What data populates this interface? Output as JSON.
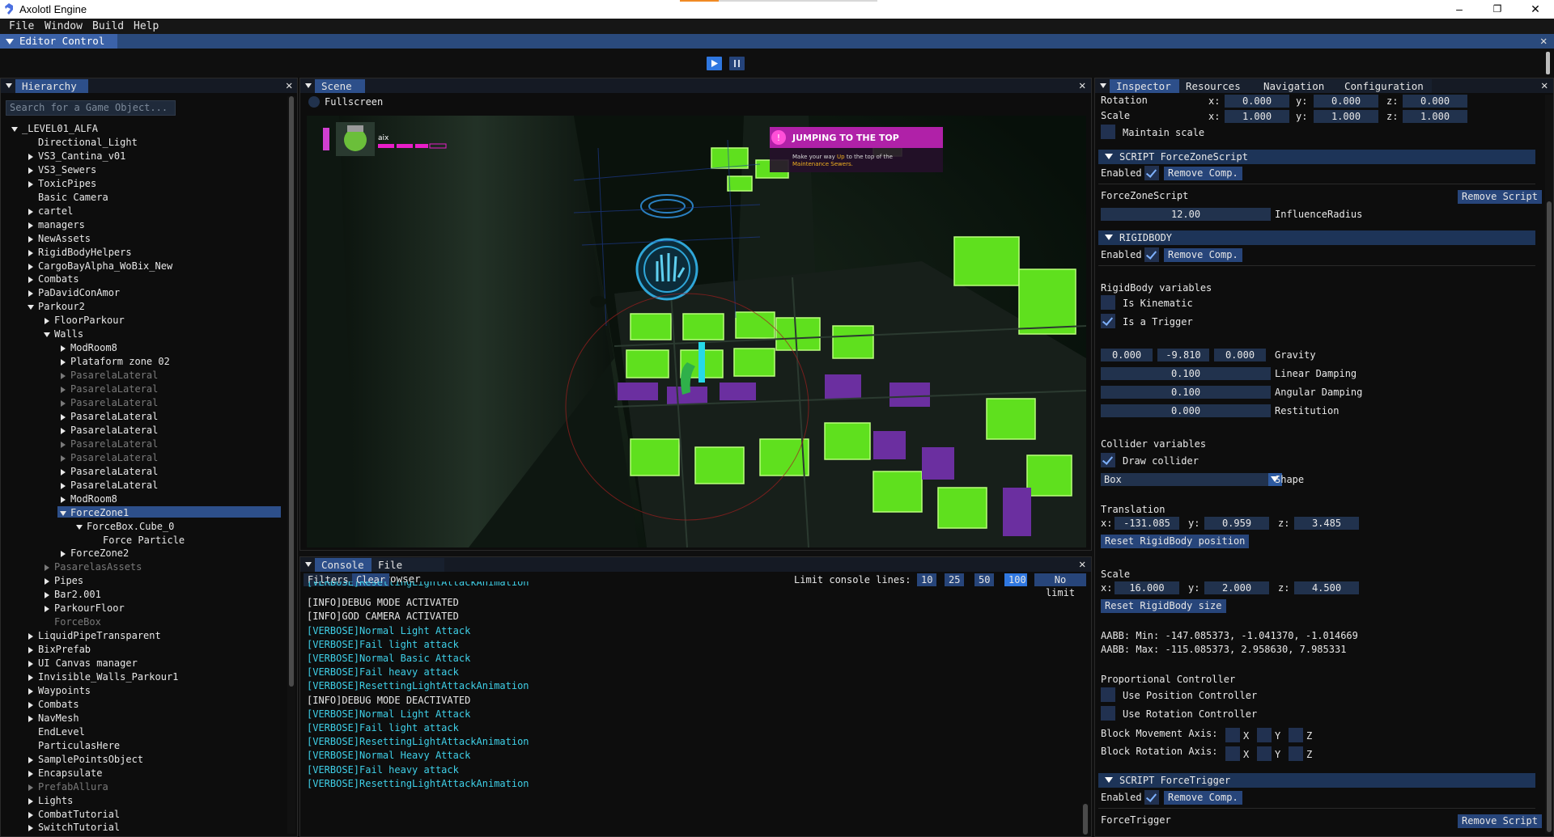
{
  "window": {
    "title": "Axolotl Engine",
    "minimize": "–",
    "maximize": "❐",
    "close": "✕"
  },
  "menu": [
    "File",
    "Window",
    "Build",
    "Help"
  ],
  "editor_control": {
    "title": "Editor Control"
  },
  "hierarchy": {
    "tab": "Hierarchy",
    "search_placeholder": "Search for a Game Object...",
    "items": [
      {
        "label": "_LEVEL01_ALFA",
        "depth": 0,
        "arrow": "down",
        "dim": false
      },
      {
        "label": "Directional_Light",
        "depth": 1,
        "arrow": "none",
        "dim": false
      },
      {
        "label": "VS3_Cantina_v01",
        "depth": 1,
        "arrow": "right",
        "dim": false
      },
      {
        "label": "VS3_Sewers",
        "depth": 1,
        "arrow": "right",
        "dim": false
      },
      {
        "label": "ToxicPipes",
        "depth": 1,
        "arrow": "right",
        "dim": false
      },
      {
        "label": "Basic Camera",
        "depth": 1,
        "arrow": "none",
        "dim": false
      },
      {
        "label": "cartel",
        "depth": 1,
        "arrow": "right",
        "dim": false
      },
      {
        "label": "managers",
        "depth": 1,
        "arrow": "right",
        "dim": false
      },
      {
        "label": "NewAssets",
        "depth": 1,
        "arrow": "right",
        "dim": false
      },
      {
        "label": "RigidBodyHelpers",
        "depth": 1,
        "arrow": "right",
        "dim": false
      },
      {
        "label": "CargoBayAlpha_WoBix_New",
        "depth": 1,
        "arrow": "right",
        "dim": false
      },
      {
        "label": "Combats",
        "depth": 1,
        "arrow": "right",
        "dim": false
      },
      {
        "label": "PaDavidConAmor",
        "depth": 1,
        "arrow": "right",
        "dim": false
      },
      {
        "label": "Parkour2",
        "depth": 1,
        "arrow": "down",
        "dim": false
      },
      {
        "label": "FloorParkour",
        "depth": 2,
        "arrow": "right",
        "dim": false
      },
      {
        "label": "Walls",
        "depth": 2,
        "arrow": "down",
        "dim": false
      },
      {
        "label": "ModRoom8",
        "depth": 3,
        "arrow": "right",
        "dim": false
      },
      {
        "label": "Plataform zone 02",
        "depth": 3,
        "arrow": "right",
        "dim": false
      },
      {
        "label": "PasarelaLateral",
        "depth": 3,
        "arrow": "right",
        "dim": true
      },
      {
        "label": "PasarelaLateral",
        "depth": 3,
        "arrow": "right",
        "dim": true
      },
      {
        "label": "PasarelaLateral",
        "depth": 3,
        "arrow": "right",
        "dim": true
      },
      {
        "label": "PasarelaLateral",
        "depth": 3,
        "arrow": "right",
        "dim": false
      },
      {
        "label": "PasarelaLateral",
        "depth": 3,
        "arrow": "right",
        "dim": false
      },
      {
        "label": "PasarelaLateral",
        "depth": 3,
        "arrow": "right",
        "dim": true
      },
      {
        "label": "PasarelaLateral",
        "depth": 3,
        "arrow": "right",
        "dim": true
      },
      {
        "label": "PasarelaLateral",
        "depth": 3,
        "arrow": "right",
        "dim": false
      },
      {
        "label": "PasarelaLateral",
        "depth": 3,
        "arrow": "right",
        "dim": false
      },
      {
        "label": "ModRoom8",
        "depth": 3,
        "arrow": "right",
        "dim": false
      },
      {
        "label": "ForceZone1",
        "depth": 3,
        "arrow": "down",
        "dim": false,
        "selected": true
      },
      {
        "label": "ForceBox.Cube_0",
        "depth": 4,
        "arrow": "down",
        "dim": false
      },
      {
        "label": "Force Particle",
        "depth": 5,
        "arrow": "none",
        "dim": false
      },
      {
        "label": "ForceZone2",
        "depth": 3,
        "arrow": "right",
        "dim": false
      },
      {
        "label": "PasarelasAssets",
        "depth": 2,
        "arrow": "right",
        "dim": true
      },
      {
        "label": "Pipes",
        "depth": 2,
        "arrow": "right",
        "dim": false
      },
      {
        "label": "Bar2.001",
        "depth": 2,
        "arrow": "right",
        "dim": false
      },
      {
        "label": "ParkourFloor",
        "depth": 2,
        "arrow": "right",
        "dim": false
      },
      {
        "label": "ForceBox",
        "depth": 2,
        "arrow": "none",
        "dim": true
      },
      {
        "label": "LiquidPipeTransparent",
        "depth": 1,
        "arrow": "right",
        "dim": false
      },
      {
        "label": "BixPrefab",
        "depth": 1,
        "arrow": "right",
        "dim": false
      },
      {
        "label": "UI Canvas manager",
        "depth": 1,
        "arrow": "right",
        "dim": false
      },
      {
        "label": "Invisible_Walls_Parkour1",
        "depth": 1,
        "arrow": "right",
        "dim": false
      },
      {
        "label": "Waypoints",
        "depth": 1,
        "arrow": "right",
        "dim": false
      },
      {
        "label": "Combats",
        "depth": 1,
        "arrow": "right",
        "dim": false
      },
      {
        "label": "NavMesh",
        "depth": 1,
        "arrow": "right",
        "dim": false
      },
      {
        "label": "EndLevel",
        "depth": 1,
        "arrow": "none",
        "dim": false
      },
      {
        "label": "ParticulasHere",
        "depth": 1,
        "arrow": "none",
        "dim": false
      },
      {
        "label": "SamplePointsObject",
        "depth": 1,
        "arrow": "right",
        "dim": false
      },
      {
        "label": "Encapsulate",
        "depth": 1,
        "arrow": "right",
        "dim": false
      },
      {
        "label": "PrefabAllura",
        "depth": 1,
        "arrow": "right",
        "dim": true
      },
      {
        "label": "Lights",
        "depth": 1,
        "arrow": "right",
        "dim": false
      },
      {
        "label": "CombatTutorial",
        "depth": 1,
        "arrow": "right",
        "dim": false
      },
      {
        "label": "SwitchTutorial",
        "depth": 1,
        "arrow": "right",
        "dim": false
      }
    ]
  },
  "scene": {
    "tab": "Scene",
    "fullscreen_label": "Fullscreen",
    "hud": {
      "player_name": "aix",
      "objective_title": "JUMPING TO THE TOP",
      "objective_text_1": "Make your way",
      "objective_highlight_1": "Up",
      "objective_text_2": "to the top of the",
      "objective_highlight_2": "Maintenance Sewers."
    }
  },
  "console": {
    "tabs": [
      "Console",
      "File Browser"
    ],
    "filters_label": "Filters",
    "clear_label": "Clear",
    "limit_label": "Limit console lines:",
    "limit_options": [
      "10",
      "25",
      "50",
      "100",
      "No limit"
    ],
    "limit_selected": "100",
    "lines": [
      {
        "text": "[VERBOSE]ResettingLightAttackAnimation",
        "kind": "verbose"
      },
      {
        "text": "[INFO]DEBUG MODE ACTIVATED",
        "kind": "info"
      },
      {
        "text": "[INFO]GOD CAMERA ACTIVATED",
        "kind": "info"
      },
      {
        "text": "[VERBOSE]Normal Light Attack",
        "kind": "verbose"
      },
      {
        "text": "[VERBOSE]Fail light attack",
        "kind": "verbose"
      },
      {
        "text": "[VERBOSE]Normal Basic Attack",
        "kind": "verbose"
      },
      {
        "text": "[VERBOSE]Fail heavy attack",
        "kind": "verbose"
      },
      {
        "text": "[VERBOSE]ResettingLightAttackAnimation",
        "kind": "verbose"
      },
      {
        "text": "[INFO]DEBUG MODE DEACTIVATED",
        "kind": "info"
      },
      {
        "text": "[VERBOSE]Normal Light Attack",
        "kind": "verbose"
      },
      {
        "text": "[VERBOSE]Fail light attack",
        "kind": "verbose"
      },
      {
        "text": "[VERBOSE]ResettingLightAttackAnimation",
        "kind": "verbose"
      },
      {
        "text": "[VERBOSE]Normal Heavy Attack",
        "kind": "verbose"
      },
      {
        "text": "[VERBOSE]Fail heavy attack",
        "kind": "verbose"
      },
      {
        "text": "[VERBOSE]ResettingLightAttackAnimation",
        "kind": "verbose"
      }
    ]
  },
  "inspector": {
    "tabs": [
      "Inspector",
      "Resources",
      "Navigation",
      "Configuration"
    ],
    "rotation": {
      "label": "Rotation",
      "x": "0.000",
      "y": "0.000",
      "z": "0.000"
    },
    "scale": {
      "label": "Scale",
      "x": "1.000",
      "y": "1.000",
      "z": "1.000"
    },
    "maintain_scale": "Maintain scale",
    "axis": {
      "x": "x:",
      "y": "y:",
      "z": "z:"
    },
    "script1": {
      "header": "SCRIPT ForceZoneScript",
      "enabled": "Enabled",
      "remove_comp": "Remove Comp.",
      "name": "ForceZoneScript",
      "remove_script": "Remove Script",
      "influence_value": "12.00",
      "influence_label": "InfluenceRadius"
    },
    "rigidbody": {
      "header": "RIGIDBODY",
      "enabled": "Enabled",
      "remove_comp": "Remove Comp.",
      "variables_label": "RigidBody variables",
      "is_kinematic": "Is Kinematic",
      "is_trigger": "Is a Trigger",
      "gravity": [
        "0.000",
        "-9.810",
        "0.000"
      ],
      "gravity_label": "Gravity",
      "linear_damping": "0.100",
      "linear_label": "Linear Damping",
      "angular_damping": "0.100",
      "angular_label": "Angular Damping",
      "restitution": "0.000",
      "restitution_label": "Restitution",
      "collider_label": "Collider variables",
      "draw_collider": "Draw collider",
      "shape_value": "Box",
      "shape_label": "Shape",
      "translation_label": "Translation",
      "translation": {
        "x": "-131.085",
        "y": "0.959",
        "z": "3.485"
      },
      "reset_position": "Reset RigidBody position",
      "scale_label": "Scale",
      "scale": {
        "x": "16.000",
        "y": "2.000",
        "z": "4.500"
      },
      "reset_size": "Reset RigidBody size",
      "aabb_min": "AABB: Min: -147.085373, -1.041370, -1.014669",
      "aabb_max": "AABB: Max: -115.085373, 2.958630, 7.985331",
      "proportional_label": "Proportional Controller",
      "use_position": "Use Position Controller",
      "use_rotation": "Use Rotation Controller",
      "block_movement": "Block Movement Axis:",
      "block_rotation": "Block Rotation Axis:",
      "axis_x": "X",
      "axis_y": "Y",
      "axis_z": "Z"
    },
    "script2": {
      "header": "SCRIPT ForceTrigger",
      "enabled": "Enabled",
      "remove_comp": "Remove Comp.",
      "name": "ForceTrigger",
      "remove_script": "Remove Script"
    }
  }
}
